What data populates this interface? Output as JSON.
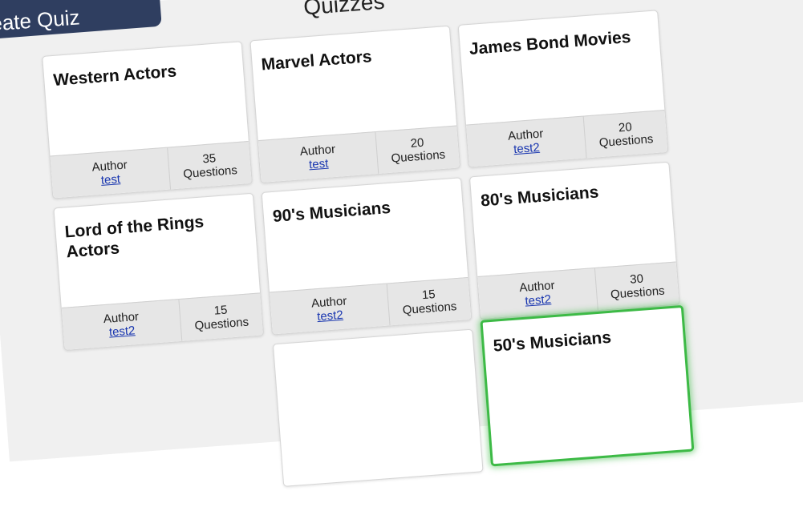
{
  "nav": {
    "create_quiz_label": "Create Quiz"
  },
  "page_title": "Quizzes",
  "quizzes": [
    {
      "title": "Western Actors",
      "author_label": "Author",
      "author": "test",
      "count": "35",
      "count_label": "Questions"
    },
    {
      "title": "Marvel Actors",
      "author_label": "Author",
      "author": "test",
      "count": "20",
      "count_label": "Questions"
    },
    {
      "title": "James Bond Movies",
      "author_label": "Author",
      "author": "test2",
      "count": "20",
      "count_label": "Questions"
    },
    {
      "title": "Lord of the Rings Actors",
      "author_label": "Author",
      "author": "test2",
      "count": "15",
      "count_label": "Questions"
    },
    {
      "title": "90's Musicians",
      "author_label": "Author",
      "author": "test2",
      "count": "15",
      "count_label": "Questions"
    },
    {
      "title": "80's Musicians",
      "author_label": "Author",
      "author": "test2",
      "count": "30",
      "count_label": "Questions"
    },
    {
      "title": "",
      "author_label": "",
      "author": "",
      "count": "",
      "count_label": ""
    },
    {
      "title": "50's Musicians",
      "author_label": "",
      "author": "",
      "count": "",
      "count_label": ""
    }
  ]
}
